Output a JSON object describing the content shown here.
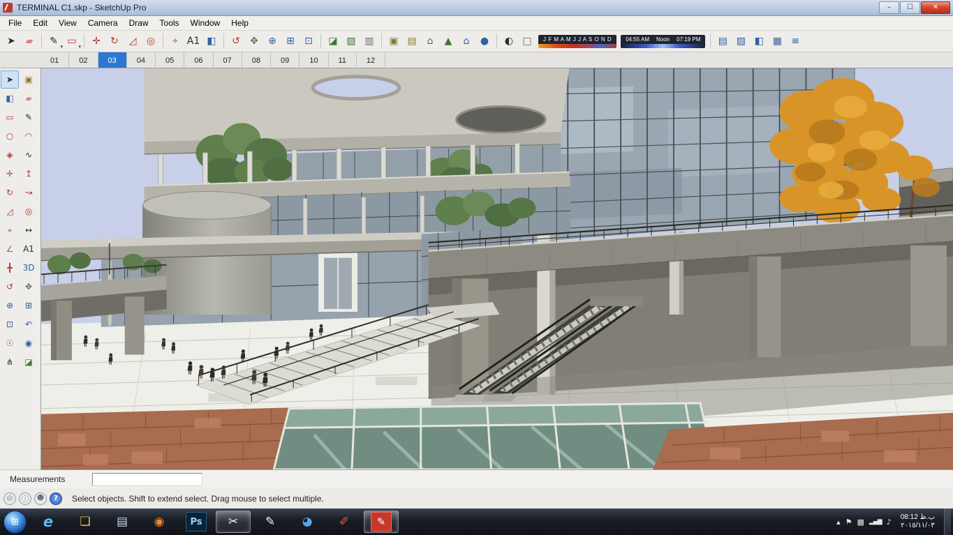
{
  "window": {
    "title": "TERMINAL C1.skp - SketchUp Pro",
    "controls": [
      {
        "name": "minimize-button",
        "glyph": "–"
      },
      {
        "name": "maximize-button",
        "glyph": "☐"
      },
      {
        "name": "close-button",
        "glyph": "✕",
        "kind": "close"
      }
    ]
  },
  "menu_bar": {
    "items": [
      {
        "label": "File",
        "name": "menu-file"
      },
      {
        "label": "Edit",
        "name": "menu-edit"
      },
      {
        "label": "View",
        "name": "menu-view"
      },
      {
        "label": "Camera",
        "name": "menu-camera"
      },
      {
        "label": "Draw",
        "name": "menu-draw"
      },
      {
        "label": "Tools",
        "name": "menu-tools"
      },
      {
        "label": "Window",
        "name": "menu-window"
      },
      {
        "label": "Help",
        "name": "menu-help"
      }
    ]
  },
  "toolbar": {
    "items": [
      {
        "name": "select-tool-button",
        "glyph": "➤",
        "tone": "dark"
      },
      {
        "name": "eraser-tool-button",
        "glyph": "▰",
        "tone": "pink"
      },
      {
        "kind": "divider"
      },
      {
        "name": "line-tool-button",
        "glyph": "✎",
        "tone": "dark",
        "dropdown": true
      },
      {
        "name": "shapes-tool-button",
        "glyph": "▭",
        "tone": "red",
        "dropdown": true
      },
      {
        "kind": "divider"
      },
      {
        "name": "move-tool-button",
        "glyph": "✛",
        "tone": "red"
      },
      {
        "name": "rotate-tool-button",
        "glyph": "↻",
        "tone": "red"
      },
      {
        "name": "scale-tool-button",
        "glyph": "◿",
        "tone": "red"
      },
      {
        "name": "offset-tool-button",
        "glyph": "◎",
        "tone": "red"
      },
      {
        "kind": "divider"
      },
      {
        "name": "tape-measure-tool-button",
        "glyph": "⌖",
        "tone": "olive"
      },
      {
        "name": "text-tool-button",
        "glyph": "A1",
        "tone": "dark"
      },
      {
        "name": "paint-bucket-tool-button",
        "glyph": "◧",
        "tone": "blue"
      },
      {
        "kind": "divider"
      },
      {
        "name": "orbit-tool-button",
        "glyph": "↺",
        "tone": "red"
      },
      {
        "name": "pan-tool-button",
        "glyph": "✥",
        "tone": "gray"
      },
      {
        "name": "zoom-tool-button",
        "glyph": "⊕",
        "tone": "blue"
      },
      {
        "name": "zoom-window-tool-button",
        "glyph": "⊞",
        "tone": "blue"
      },
      {
        "name": "zoom-extents-tool-button",
        "glyph": "⊡",
        "tone": "blue"
      },
      {
        "kind": "divider"
      },
      {
        "name": "section-plane-tool-button",
        "glyph": "◪",
        "tone": "green"
      },
      {
        "name": "display-section-planes-button",
        "glyph": "▧",
        "tone": "green"
      },
      {
        "name": "display-section-cuts-button",
        "glyph": "▥",
        "tone": "gray"
      },
      {
        "kind": "divider"
      },
      {
        "name": "get-models-button",
        "glyph": "▣",
        "tone": "olive"
      },
      {
        "name": "share-model-button",
        "glyph": "▤",
        "tone": "olive"
      },
      {
        "name": "add-location-button",
        "glyph": "⌂",
        "tone": "green"
      },
      {
        "name": "toggle-terrain-button",
        "glyph": "▲",
        "tone": "green"
      },
      {
        "name": "photo-textures-button",
        "glyph": "⌂",
        "tone": "blue"
      },
      {
        "name": "preview-in-earth-button",
        "glyph": "●",
        "tone": "blue"
      },
      {
        "kind": "divider"
      },
      {
        "name": "shadow-settings-button",
        "glyph": "◐",
        "tone": "dark"
      },
      {
        "name": "shadow-toggle-button",
        "glyph": "□",
        "tone": "gray"
      }
    ],
    "shadows": {
      "months": "J F M A M J J A S O N D",
      "time_start": "04:55 AM",
      "time_noon": "Noon",
      "time_end": "07:19 PM"
    },
    "right_items": [
      {
        "name": "layers-panel-button",
        "glyph": "▤",
        "tone": "blue"
      },
      {
        "name": "materials-panel-button",
        "glyph": "▨",
        "tone": "blue"
      },
      {
        "name": "styles-panel-button",
        "glyph": "◧",
        "tone": "blue"
      },
      {
        "name": "scenes-panel-button",
        "glyph": "▦",
        "tone": "blue"
      },
      {
        "name": "outliner-panel-button",
        "glyph": "≡",
        "tone": "blue"
      }
    ]
  },
  "scene_tabs": [
    {
      "label": "01",
      "name": "scene-tab-01"
    },
    {
      "label": "02",
      "name": "scene-tab-02"
    },
    {
      "label": "03",
      "name": "scene-tab-03",
      "active": true
    },
    {
      "label": "04",
      "name": "scene-tab-04"
    },
    {
      "label": "05",
      "name": "scene-tab-05"
    },
    {
      "label": "06",
      "name": "scene-tab-06"
    },
    {
      "label": "07",
      "name": "scene-tab-07"
    },
    {
      "label": "08",
      "name": "scene-tab-08"
    },
    {
      "label": "09",
      "name": "scene-tab-09"
    },
    {
      "label": "10",
      "name": "scene-tab-10"
    },
    {
      "label": "11",
      "name": "scene-tab-11"
    },
    {
      "label": "12",
      "name": "scene-tab-12"
    }
  ],
  "tool_palette": [
    {
      "name": "select-tool",
      "glyph": "➤",
      "tone": "dark",
      "active": true
    },
    {
      "name": "make-component-tool",
      "glyph": "▣",
      "tone": "olive"
    },
    {
      "name": "paint-bucket-tool",
      "glyph": "◧",
      "tone": "blue"
    },
    {
      "name": "eraser-tool",
      "glyph": "▰",
      "tone": "pink"
    },
    {
      "name": "rectangle-tool",
      "glyph": "▭",
      "tone": "red"
    },
    {
      "name": "line-tool",
      "glyph": "✎",
      "tone": "dark"
    },
    {
      "name": "circle-tool",
      "glyph": "○",
      "tone": "red"
    },
    {
      "name": "arc-tool",
      "glyph": "◠",
      "tone": "red"
    },
    {
      "name": "polygon-tool",
      "glyph": "◈",
      "tone": "red"
    },
    {
      "name": "freehand-tool",
      "glyph": "∿",
      "tone": "dark"
    },
    {
      "name": "move-tool",
      "glyph": "✛",
      "tone": "red"
    },
    {
      "name": "push-pull-tool",
      "glyph": "↥",
      "tone": "red"
    },
    {
      "name": "rotate-tool",
      "glyph": "↻",
      "tone": "red"
    },
    {
      "name": "follow-me-tool",
      "glyph": "↝",
      "tone": "red"
    },
    {
      "name": "scale-tool",
      "glyph": "◿",
      "tone": "red"
    },
    {
      "name": "offset-tool",
      "glyph": "◎",
      "tone": "red"
    },
    {
      "name": "tape-measure-tool",
      "glyph": "⌖",
      "tone": "olive"
    },
    {
      "name": "dimension-tool",
      "glyph": "↔",
      "tone": "dark"
    },
    {
      "name": "protractor-tool",
      "glyph": "∠",
      "tone": "olive"
    },
    {
      "name": "text-tool",
      "glyph": "A1",
      "tone": "dark"
    },
    {
      "name": "axes-tool",
      "glyph": "╋",
      "tone": "red"
    },
    {
      "name": "3d-text-tool",
      "glyph": "3D",
      "tone": "blue"
    },
    {
      "name": "orbit-tool",
      "glyph": "↺",
      "tone": "red"
    },
    {
      "name": "pan-tool",
      "glyph": "✥",
      "tone": "gray"
    },
    {
      "name": "zoom-tool",
      "glyph": "⊕",
      "tone": "blue"
    },
    {
      "name": "zoom-window-tool",
      "glyph": "⊞",
      "tone": "blue"
    },
    {
      "name": "zoom-extents-tool",
      "glyph": "⊡",
      "tone": "blue"
    },
    {
      "name": "previous-view-tool",
      "glyph": "↶",
      "tone": "blue"
    },
    {
      "name": "position-camera-tool",
      "glyph": "☉",
      "tone": "olive"
    },
    {
      "name": "look-around-tool",
      "glyph": "◉",
      "tone": "blue"
    },
    {
      "name": "walk-tool",
      "glyph": "⋔",
      "tone": "dark"
    },
    {
      "name": "section-plane-tool",
      "glyph": "◪",
      "tone": "green"
    }
  ],
  "viewport": {
    "background_color": "#C8CFE9"
  },
  "measurements": {
    "label": "Measurements",
    "value": ""
  },
  "status_bar": {
    "icons": [
      {
        "name": "geolocation-icon",
        "glyph": "◎"
      },
      {
        "name": "claim-credit-icon",
        "glyph": "ⓘ"
      },
      {
        "name": "sign-in-icon",
        "glyph": "☻"
      },
      {
        "name": "help-icon",
        "glyph": "?"
      }
    ],
    "message": "Select objects. Shift to extend select. Drag mouse to select multiple."
  },
  "taskbar": {
    "start_glyph": "⊞",
    "apps": [
      {
        "name": "taskbar-internet-explorer",
        "glyph": "e"
      },
      {
        "name": "taskbar-windows-explorer",
        "glyph": "❏"
      },
      {
        "name": "taskbar-text-editor",
        "glyph": "▤"
      },
      {
        "name": "taskbar-media-player",
        "glyph": "◉"
      },
      {
        "name": "taskbar-photoshop",
        "glyph": "Ps"
      },
      {
        "name": "taskbar-snipping-tool",
        "glyph": "✂",
        "active": true
      },
      {
        "name": "taskbar-pen-notes",
        "glyph": "✎"
      },
      {
        "name": "taskbar-google-earth",
        "glyph": "◕"
      },
      {
        "name": "taskbar-style-builder",
        "glyph": "✐"
      },
      {
        "name": "taskbar-sketchup",
        "glyph": "✎",
        "active": true
      }
    ],
    "tray_icons": [
      {
        "name": "tray-expand-icon",
        "glyph": "▴"
      },
      {
        "name": "tray-action-center-icon",
        "glyph": "⚑"
      },
      {
        "name": "tray-activity-icon",
        "glyph": "▦"
      },
      {
        "name": "tray-network-icon",
        "glyph": "▂▄▆"
      },
      {
        "name": "tray-volume-icon",
        "glyph": "♪"
      }
    ],
    "clock_time": "ب.ظ 08:12",
    "clock_date": "٢٠١٥/١١/٠٣"
  },
  "colors": {
    "active_tab_blue": "#2E77D0",
    "sky": "#C8CFE9",
    "close_button_red": "#D6492F",
    "taskbar_dark": "#14171E",
    "brick_paving": "#A86C4E",
    "glass_facade": "#9AA7B2"
  }
}
